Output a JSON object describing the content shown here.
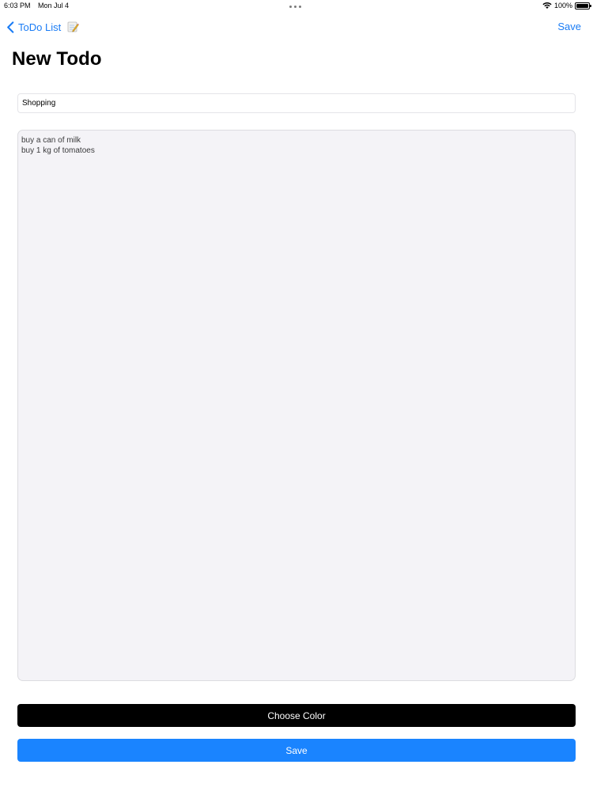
{
  "status_bar": {
    "time": "6:03 PM",
    "date": "Mon Jul 4",
    "battery": "100%",
    "icons": [
      "wifi-icon",
      "battery-icon"
    ]
  },
  "nav": {
    "back_label": "ToDo List",
    "back_icon": "chevron-left-icon",
    "title_emoji_icon": "memo-icon",
    "save_label": "Save",
    "accent_color": "#1a7cf5"
  },
  "page": {
    "title": "New Todo"
  },
  "form": {
    "title_value": "Shopping",
    "notes_value": "buy a can of milk\nbuy 1 kg of tomatoes"
  },
  "buttons": {
    "choose_color_label": "Choose Color",
    "choose_color_bg": "#000000",
    "save_label": "Save",
    "save_bg": "#1a84ff"
  }
}
